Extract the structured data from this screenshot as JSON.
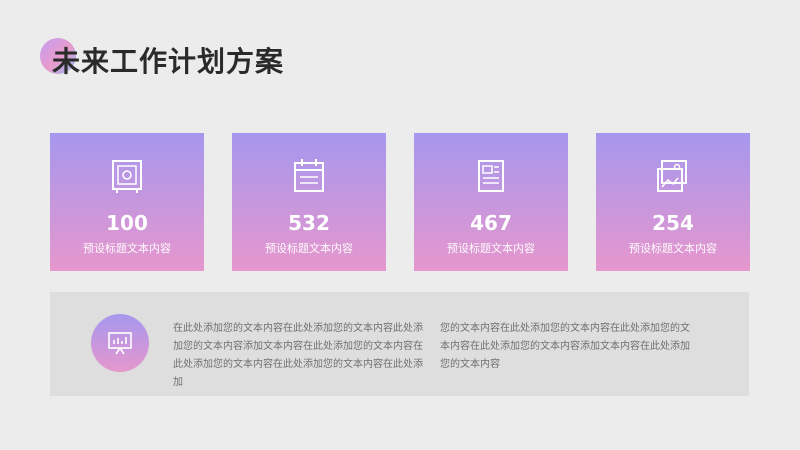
{
  "title": "未来工作计划方案",
  "cards": [
    {
      "value": "100",
      "label": "预设标题文本内容",
      "icon": "safe-icon"
    },
    {
      "value": "532",
      "label": "预设标题文本内容",
      "icon": "calendar-icon"
    },
    {
      "value": "467",
      "label": "预设标题文本内容",
      "icon": "newspaper-icon"
    },
    {
      "value": "254",
      "label": "预设标题文本内容",
      "icon": "image-frame-icon"
    }
  ],
  "panel": {
    "icon": "presentation-chart-icon",
    "paragraph_left": "在此处添加您的文本内容在此处添加您的文本内容此处添加您的文本内容添加文本内容在此处添加您的文本内容在此处添加您的文本内容在此处添加您的文本内容在此处添加",
    "paragraph_right": "您的文本内容在此处添加您的文本内容在此处添加您的文本内容在此处添加您的文本内容添加文本内容在此处添加您的文本内容"
  },
  "colors": {
    "gradient_top": "#a697ee",
    "gradient_bottom": "#e697cd",
    "background": "#ececec",
    "panel": "#dedede"
  }
}
